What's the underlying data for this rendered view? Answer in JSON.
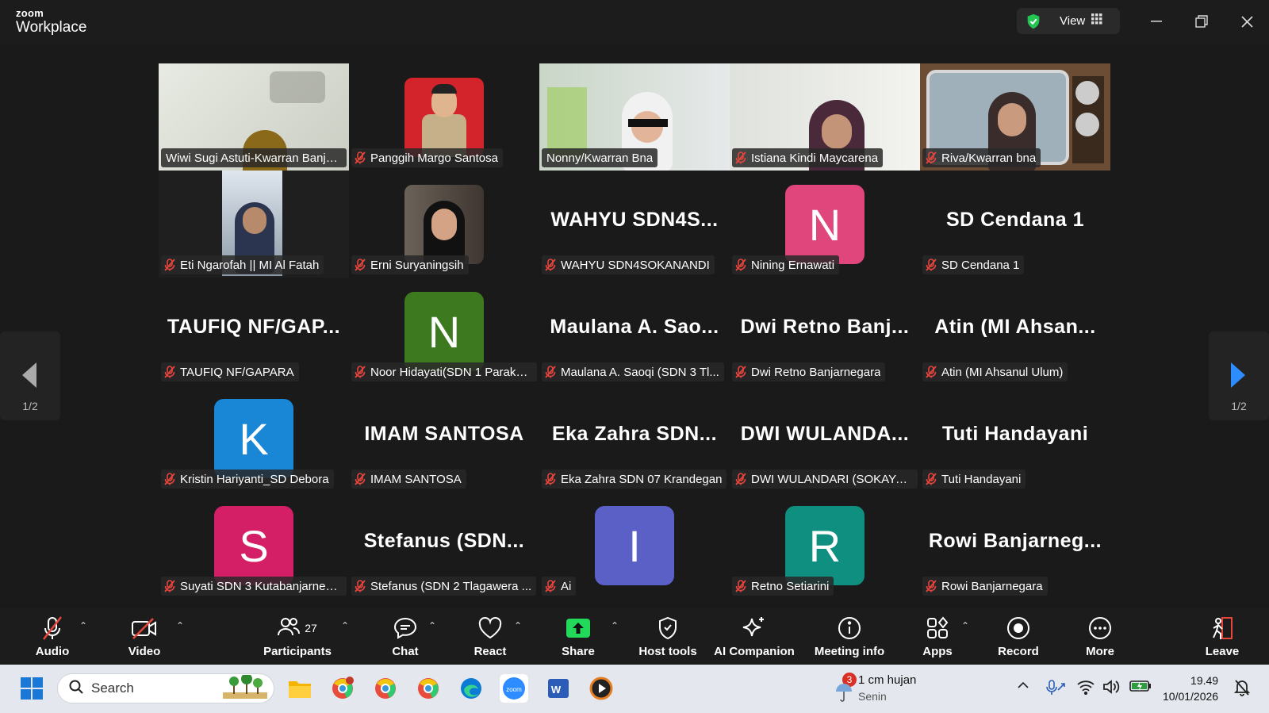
{
  "app": {
    "logo_small": "zoom",
    "logo_large": "Workplace",
    "view_label": "View"
  },
  "colors": {
    "active_border": "#23d959",
    "mute_red": "#e8453c",
    "arrow_active": "#2d8cff"
  },
  "gallery": {
    "page_indicator_left": "1/2",
    "page_indicator_right": "1/2",
    "tiles": [
      {
        "name": "Wiwi Sugi Astuti-Kwarran Banja...",
        "muted": false,
        "kind": "video",
        "active": true
      },
      {
        "name": "Panggih Margo Santosa",
        "muted": true,
        "kind": "photo"
      },
      {
        "name": "Nonny/Kwarran Bna",
        "muted": false,
        "kind": "video"
      },
      {
        "name": "Istiana Kindi Maycarena",
        "muted": true,
        "kind": "video"
      },
      {
        "name": "Riva/Kwarran bna",
        "muted": true,
        "kind": "video"
      },
      {
        "name": "Eti Ngarofah || MI Al Fatah",
        "muted": true,
        "kind": "video"
      },
      {
        "name": "Erni Suryaningsih",
        "muted": true,
        "kind": "photo"
      },
      {
        "name": "WAHYU SDN4SOKANANDI",
        "muted": true,
        "kind": "text",
        "big": "WAHYU SDN4S..."
      },
      {
        "name": "Nining Ernawati",
        "muted": true,
        "kind": "avatar",
        "letter": "N",
        "color": "#e0457b"
      },
      {
        "name": "SD Cendana 1",
        "muted": true,
        "kind": "text",
        "big": "SD Cendana 1"
      },
      {
        "name": "TAUFIQ NF/GAPARA",
        "muted": true,
        "kind": "text",
        "big": "TAUFIQ NF/GAP..."
      },
      {
        "name": "Noor Hidayati(SDN 1 Paraka...",
        "muted": true,
        "kind": "avatar",
        "letter": "N",
        "color": "#3d7a1f"
      },
      {
        "name": "Maulana A. Saoqi (SDN 3 Tl...",
        "muted": true,
        "kind": "text",
        "big": "Maulana A. Sao..."
      },
      {
        "name": "Dwi Retno Banjarnegara",
        "muted": true,
        "kind": "text",
        "big": "Dwi Retno Banj..."
      },
      {
        "name": "Atin (MI Ahsanul Ulum)",
        "muted": true,
        "kind": "text",
        "big": "Atin (MI Ahsan..."
      },
      {
        "name": "Kristin Hariyanti_SD Debora",
        "muted": true,
        "kind": "avatar",
        "letter": "K",
        "color": "#1a86d6"
      },
      {
        "name": "IMAM SANTOSA",
        "muted": true,
        "kind": "text",
        "big": "IMAM SANTOSA"
      },
      {
        "name": "Eka Zahra SDN 07 Krandegan",
        "muted": true,
        "kind": "text",
        "big": "Eka Zahra SDN..."
      },
      {
        "name": "DWI WULANDARI (SOKAYAS...",
        "muted": true,
        "kind": "text",
        "big": "DWI WULANDA..."
      },
      {
        "name": "Tuti Handayani",
        "muted": true,
        "kind": "text",
        "big": "Tuti Handayani"
      },
      {
        "name": "Suyati SDN 3 Kutabanjarneg...",
        "muted": true,
        "kind": "avatar",
        "letter": "S",
        "color": "#d41f66"
      },
      {
        "name": "Stefanus (SDN 2 Tlagawera ...",
        "muted": true,
        "kind": "text",
        "big": "Stefanus (SDN..."
      },
      {
        "name": "Ai",
        "muted": true,
        "kind": "avatar",
        "letter": "I",
        "color": "#5b60c7"
      },
      {
        "name": "Retno Setiarini",
        "muted": true,
        "kind": "avatar",
        "letter": "R",
        "color": "#0f8f7f"
      },
      {
        "name": "Rowi Banjarnegara",
        "muted": true,
        "kind": "text",
        "big": "Rowi Banjarneg..."
      }
    ]
  },
  "toolbar": {
    "audio": "Audio",
    "video": "Video",
    "participants": "Participants",
    "participants_count": "27",
    "chat": "Chat",
    "react": "React",
    "share": "Share",
    "host_tools": "Host tools",
    "ai_companion": "AI Companion",
    "meeting_info": "Meeting info",
    "apps": "Apps",
    "record": "Record",
    "more": "More",
    "leave": "Leave"
  },
  "taskbar": {
    "search_placeholder": "Search",
    "weather_badge": "3",
    "weather_title": "1 cm hujan",
    "weather_sub": "Senin",
    "time": "19.49",
    "date": "10/01/2026"
  }
}
